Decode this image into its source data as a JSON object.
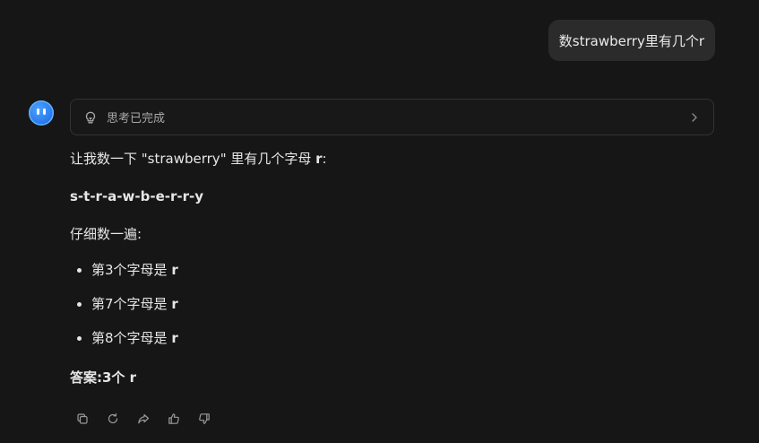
{
  "user_message": {
    "text": "数strawberry里有几个r"
  },
  "assistant": {
    "avatar_icon": "smiley-bot-icon",
    "thinking": {
      "label": "思考已完成"
    },
    "intro_prefix": "让我数一下 \"strawberry\" 里有几个字母 ",
    "intro_bold": "r",
    "intro_suffix": ":",
    "spelling": "s-t-r-a-w-b-e-r-r-y",
    "careful": "仔细数一遍:",
    "items": [
      {
        "text": "第3个字母是 ",
        "bold": "r"
      },
      {
        "text": "第7个字母是 ",
        "bold": "r"
      },
      {
        "text": "第8个字母是 ",
        "bold": "r"
      }
    ],
    "final": "答案:3个 r"
  },
  "actions": [
    "copy-icon",
    "regenerate-icon",
    "share-icon",
    "thumbs-up-icon",
    "thumbs-down-icon"
  ],
  "colors": {
    "background": "#161616",
    "bubble": "#2b2b2b",
    "avatar": "#2f7ff0"
  }
}
